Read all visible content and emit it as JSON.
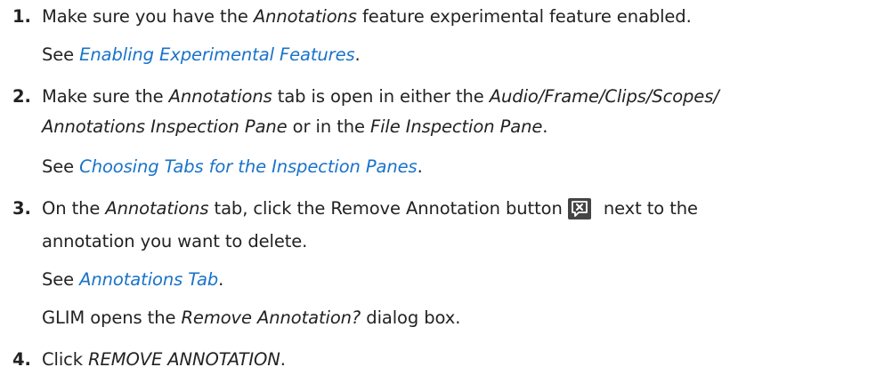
{
  "steps": [
    {
      "number": "1.",
      "lines": [
        {
          "pre": "Make sure you have the ",
          "em": "Annotations",
          "post": " feature experimental feature enabled."
        },
        {
          "see_prefix": "See ",
          "link": "Enabling Experimental Features",
          "see_suffix": "."
        }
      ]
    },
    {
      "number": "2.",
      "lines": [
        {
          "pre": "Make sure the ",
          "em": "Annotations",
          "mid": " tab is open in either the ",
          "em2": "Audio/Frame/Clips/Scopes/"
        },
        {
          "em": "Annotations Inspection Pane",
          "mid": " or in the ",
          "em2": "File Inspection Pane",
          "post": "."
        },
        {
          "see_prefix": "See ",
          "link": "Choosing Tabs for the Inspection Panes",
          "see_suffix": "."
        }
      ]
    },
    {
      "number": "3.",
      "lines": [
        {
          "pre": "On the ",
          "em": "Annotations",
          "mid": " tab, click the Remove Annotation button",
          "post": " next to the"
        },
        {
          "text": "annotation you want to delete."
        },
        {
          "see_prefix": "See ",
          "link": "Annotations Tab",
          "see_suffix": "."
        },
        {
          "pre": "GLIM opens the ",
          "em": "Remove Annotation?",
          "post": " dialog box."
        }
      ]
    },
    {
      "number": "4.",
      "lines": [
        {
          "pre": "Click ",
          "em": "REMOVE ANNOTATION",
          "post": "."
        }
      ]
    }
  ],
  "icons": {
    "remove_annotation": "remove-annotation-icon"
  },
  "colors": {
    "text": "#222222",
    "link": "#1a73c9",
    "icon_bg": "#444444"
  }
}
